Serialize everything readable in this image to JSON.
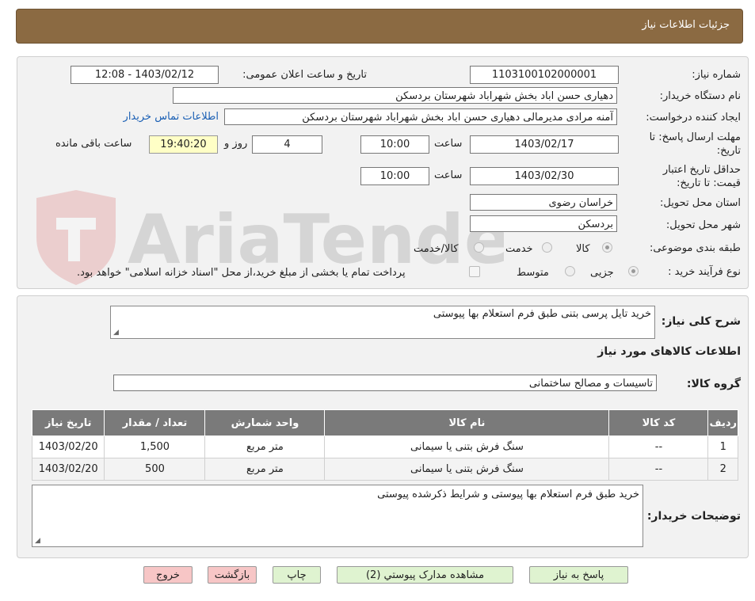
{
  "header": {
    "title": "جزئیات اطلاعات نیاز"
  },
  "watermark": {
    "text": "AriaTender.neT"
  },
  "form": {
    "need_number_label": "شماره نیاز:",
    "need_number": "1103100102000001",
    "announce_label": "تاریخ و ساعت اعلان عمومی:",
    "announce_value": "1403/02/12 - 12:08",
    "buyer_label": "نام دستگاه خریدار:",
    "buyer_value": "دهیاری حسن اباد بخش شهراباد شهرستان بردسکن",
    "creator_label": "ایجاد کننده درخواست:",
    "creator_value": "آمنه مرادی مدیرمالی دهیاری حسن اباد بخش شهراباد شهرستان بردسکن",
    "contact_link": "اطلاعات تماس خریدار",
    "deadline_label_1": "مهلت ارسال پاسخ: تا",
    "deadline_label_2": "تاریخ:",
    "deadline_date": "1403/02/17",
    "time_label": "ساعت",
    "deadline_time": "10:00",
    "days_value": "4",
    "days_label": "روز و",
    "remaining_time": "19:40:20",
    "remaining_label": "ساعت باقی مانده",
    "validity_label_1": "حداقل تاریخ اعتبار",
    "validity_label_2": "قیمت: تا تاریخ:",
    "validity_date": "1403/02/30",
    "validity_time": "10:00",
    "province_label": "استان محل تحویل:",
    "province_value": "خراسان رضوی",
    "city_label": "شهر محل تحویل:",
    "city_value": "بردسکن",
    "category_label": "طبقه بندی موضوعی:",
    "category_options": [
      "کالا",
      "خدمت",
      "کالا/خدمت"
    ],
    "process_label": "نوع فرآیند خرید :",
    "process_options": [
      "جزیی",
      "متوسط"
    ],
    "process_note": "پرداخت تمام یا بخشی از مبلغ خرید،از محل \"اسناد خزانه اسلامی\" خواهد بود."
  },
  "details": {
    "summary_label": "شرح کلی نیاز:",
    "summary_value": "خرید تایل پرسی بتنی طبق فرم استعلام بها پیوستی",
    "goods_info_title": "اطلاعات کالاهای مورد نیاز",
    "group_label": "گروه کالا:",
    "group_value": "تاسیسات و مصالح ساختمانی",
    "table": {
      "headers": [
        "ردیف",
        "کد کالا",
        "نام کالا",
        "واحد شمارش",
        "تعداد / مقدار",
        "تاریخ نیاز"
      ],
      "rows": [
        [
          "1",
          "--",
          "سنگ فرش بتنی یا سیمانی",
          "متر مربع",
          "1,500",
          "1403/02/20"
        ],
        [
          "2",
          "--",
          "سنگ فرش بتنی یا سیمانی",
          "متر مربع",
          "500",
          "1403/02/20"
        ]
      ]
    },
    "buyer_notes_label": "توضیحات خریدار:",
    "buyer_notes_value": "خرید طبق فرم استعلام بها پیوستی و شرایط ذکرشده پیوستی"
  },
  "buttons": {
    "reply": "پاسخ به نیاز",
    "attachments": "مشاهده مدارک پیوستي (2)",
    "print": "چاپ",
    "back": "بازگشت",
    "exit": "خروج"
  }
}
